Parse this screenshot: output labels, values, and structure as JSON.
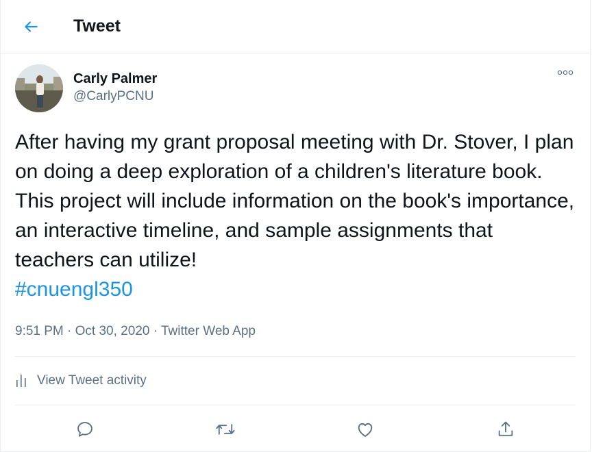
{
  "header": {
    "title": "Tweet",
    "back_icon": "arrow-left-icon"
  },
  "author": {
    "display_name": "Carly Palmer",
    "handle": "@CarlyPCNU"
  },
  "tweet": {
    "text": "After having my grant proposal meeting with Dr. Stover, I plan on doing a deep exploration of a children's literature book. This project will include information on the book's importance, an interactive timeline, and sample assignments that teachers can utilize!",
    "hashtag": "#cnuengl350"
  },
  "meta": {
    "time": "9:51 PM",
    "separator": " · ",
    "date": "Oct 30, 2020",
    "source": "Twitter Web App"
  },
  "activity": {
    "label": "View Tweet activity"
  },
  "colors": {
    "accent": "#1b95e0",
    "secondary_text": "#5b7083",
    "border": "#ebeef0"
  },
  "actions": [
    "reply-icon",
    "retweet-icon",
    "like-icon",
    "share-icon"
  ]
}
